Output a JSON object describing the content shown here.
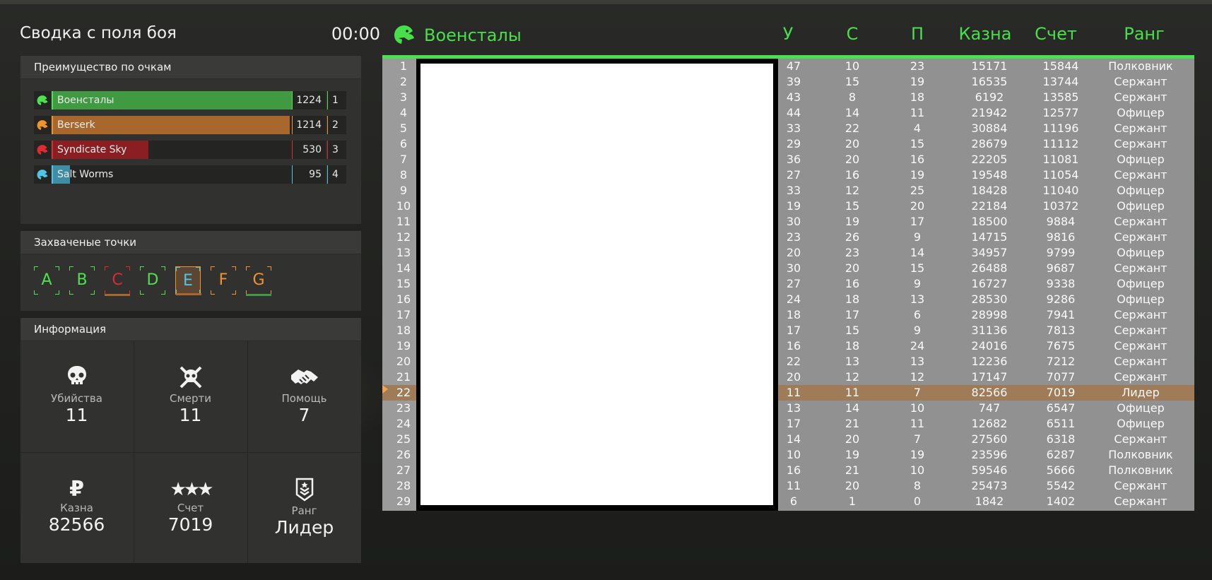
{
  "header": {
    "title": "Сводка с поля боя",
    "timer": "00:00"
  },
  "score_panel": {
    "title": "Преимущество по очкам",
    "teams": [
      {
        "name": "Военсталы",
        "points": "1224",
        "place": "1",
        "color": "#3f9a41",
        "accent": "#4ee04f",
        "fill_fraction": 1.0
      },
      {
        "name": "Berserk",
        "points": "1214",
        "place": "2",
        "color": "#a8682d",
        "accent": "#f0932a",
        "fill_fraction": 0.99
      },
      {
        "name": "Syndicate Sky",
        "points": "530",
        "place": "3",
        "color": "#8a1e22",
        "accent": "#e02a33",
        "fill_fraction": 0.4
      },
      {
        "name": "Salt Worms",
        "points": "95",
        "place": "4",
        "color": "#3f8da4",
        "accent": "#4fc4e4",
        "fill_fraction": 0.07
      }
    ]
  },
  "capture_panel": {
    "title": "Захваченые точки",
    "points": [
      {
        "letter": "A",
        "color": "#4ee04f",
        "owner_bar": ""
      },
      {
        "letter": "B",
        "color": "#4ee04f",
        "owner_bar": ""
      },
      {
        "letter": "C",
        "color": "#e02a33",
        "owner_bar": "#a8682d"
      },
      {
        "letter": "D",
        "color": "#4ee04f",
        "owner_bar": ""
      },
      {
        "letter": "E",
        "color": "#4fc4e4",
        "owner_bar": "#a8682d"
      },
      {
        "letter": "F",
        "color": "#f0932a",
        "owner_bar": ""
      },
      {
        "letter": "G",
        "color": "#f0932a",
        "owner_bar": "#3f9a41"
      }
    ]
  },
  "info_panel": {
    "title": "Информация",
    "stats": [
      {
        "label": "Убийства",
        "value": "11",
        "icon": "skull-icon"
      },
      {
        "label": "Смерти",
        "value": "11",
        "icon": "skull-crossbones-icon"
      },
      {
        "label": "Помощь",
        "value": "7",
        "icon": "handshake-icon"
      },
      {
        "label": "Казна",
        "value": "82566",
        "icon": "ruble-icon"
      },
      {
        "label": "Счет",
        "value": "7019",
        "icon": "stars-icon"
      },
      {
        "label": "Ранг",
        "value": "Лидер",
        "icon": "rank-badge-icon"
      }
    ]
  },
  "scoreboard": {
    "team_name": "Военсталы",
    "columns": [
      "У",
      "С",
      "П",
      "Казна",
      "Счет",
      "Ранг"
    ],
    "highlight_row": "22",
    "rows": [
      [
        "1",
        "47",
        "10",
        "23",
        "15171",
        "15844",
        "Полковник"
      ],
      [
        "2",
        "39",
        "15",
        "19",
        "16535",
        "13744",
        "Сержант"
      ],
      [
        "3",
        "43",
        "8",
        "18",
        "6192",
        "13585",
        "Сержант"
      ],
      [
        "4",
        "44",
        "14",
        "11",
        "21942",
        "12577",
        "Офицер"
      ],
      [
        "5",
        "33",
        "22",
        "4",
        "30884",
        "11196",
        "Сержант"
      ],
      [
        "6",
        "29",
        "20",
        "15",
        "28679",
        "11112",
        "Сержант"
      ],
      [
        "7",
        "36",
        "20",
        "16",
        "22205",
        "11081",
        "Офицер"
      ],
      [
        "8",
        "27",
        "16",
        "19",
        "19548",
        "11054",
        "Сержант"
      ],
      [
        "9",
        "33",
        "12",
        "25",
        "18428",
        "11040",
        "Офицер"
      ],
      [
        "10",
        "19",
        "15",
        "20",
        "22184",
        "10372",
        "Офицер"
      ],
      [
        "11",
        "30",
        "19",
        "17",
        "18500",
        "9884",
        "Сержант"
      ],
      [
        "12",
        "23",
        "26",
        "9",
        "14715",
        "9816",
        "Сержант"
      ],
      [
        "13",
        "20",
        "23",
        "14",
        "34957",
        "9799",
        "Офицер"
      ],
      [
        "14",
        "30",
        "20",
        "15",
        "26488",
        "9687",
        "Сержант"
      ],
      [
        "15",
        "27",
        "16",
        "9",
        "16727",
        "9338",
        "Офицер"
      ],
      [
        "16",
        "24",
        "18",
        "13",
        "28530",
        "9286",
        "Офицер"
      ],
      [
        "17",
        "18",
        "17",
        "6",
        "28998",
        "7941",
        "Сержант"
      ],
      [
        "18",
        "17",
        "15",
        "9",
        "31136",
        "7813",
        "Сержант"
      ],
      [
        "19",
        "16",
        "18",
        "24",
        "24016",
        "7675",
        "Сержант"
      ],
      [
        "20",
        "22",
        "13",
        "13",
        "12236",
        "7212",
        "Сержант"
      ],
      [
        "21",
        "20",
        "12",
        "12",
        "17147",
        "7077",
        "Сержант"
      ],
      [
        "22",
        "11",
        "11",
        "7",
        "82566",
        "7019",
        "Лидер"
      ],
      [
        "23",
        "13",
        "14",
        "10",
        "747",
        "6547",
        "Офицер"
      ],
      [
        "24",
        "17",
        "21",
        "11",
        "12682",
        "6511",
        "Офицер"
      ],
      [
        "25",
        "14",
        "20",
        "7",
        "27560",
        "6318",
        "Сержант"
      ],
      [
        "26",
        "10",
        "19",
        "19",
        "23596",
        "6287",
        "Полковник"
      ],
      [
        "27",
        "16",
        "21",
        "10",
        "59546",
        "5666",
        "Полковник"
      ],
      [
        "28",
        "11",
        "20",
        "8",
        "25473",
        "5542",
        "Сержант"
      ],
      [
        "29",
        "6",
        "1",
        "0",
        "1842",
        "1402",
        "Сержант"
      ]
    ]
  }
}
